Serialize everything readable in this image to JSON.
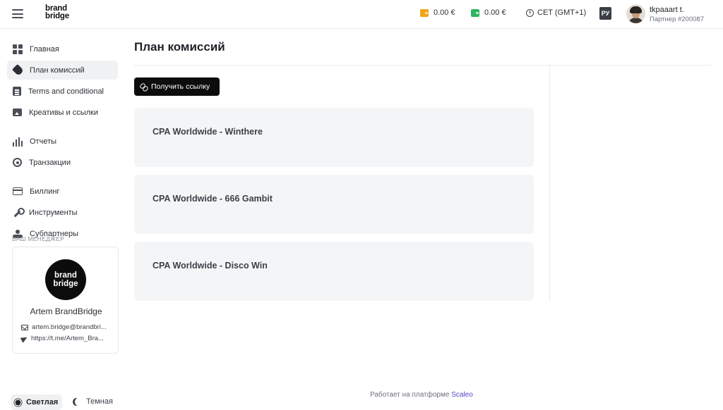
{
  "header": {
    "logo_line1": "brand",
    "logo_line2": "bridge",
    "wallet1": "0.00 €",
    "wallet2": "0.00 €",
    "timezone": "CET (GMT+1)",
    "language": "РУ",
    "user_name": "tkpaaart t.",
    "user_id": "Партнер #200087"
  },
  "sidebar": {
    "items": [
      {
        "label": "Главная",
        "icon": "dashboard-icon"
      },
      {
        "label": "План комиссий",
        "icon": "tag-icon",
        "active": true
      },
      {
        "label": "Terms and conditional",
        "icon": "document-icon"
      },
      {
        "label": "Креативы и ссылки",
        "icon": "image-icon"
      },
      {
        "label": "Отчеты",
        "icon": "bar-chart-icon"
      },
      {
        "label": "Транзакции",
        "icon": "target-icon"
      },
      {
        "label": "Биллинг",
        "icon": "credit-card-icon"
      },
      {
        "label": "Инструменты",
        "icon": "wrench-icon"
      },
      {
        "label": "Субпартнеры",
        "icon": "hand-coin-icon"
      }
    ],
    "manager": {
      "section_label": "ВАШ МЕНЕДЖЕР",
      "logo_line1": "brand",
      "logo_line2": "bridge",
      "name": "Artem BrandBridge",
      "email": "artem.bridge@brandbri...",
      "telegram": "https://t.me/Artem_Bra..."
    },
    "theme": {
      "light": "Светлая",
      "dark": "Темная"
    }
  },
  "main": {
    "title": "План комиссий",
    "get_link_button": "Получить ссылку",
    "plans": [
      {
        "title": "CPA Worldwide - Winthere"
      },
      {
        "title": "CPA Worldwide - 666 Gambit"
      },
      {
        "title": "CPA Worldwide - Disco Win"
      }
    ]
  },
  "footer": {
    "text": "Работает на платформе",
    "link": "Scaleo"
  },
  "colors": {
    "accent_link": "#4f46c8",
    "wallet_yellow": "#f2a515",
    "wallet_green": "#2fb562",
    "card_bg": "#f4f5f6"
  }
}
